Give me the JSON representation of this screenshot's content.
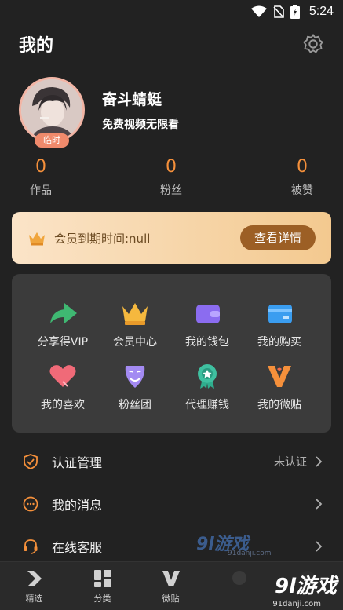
{
  "status_bar": {
    "time": "5:24"
  },
  "header": {
    "title": "我的"
  },
  "profile": {
    "username": "奋斗蜻蜓",
    "subtitle": "免费视频无限看",
    "badge": "临时"
  },
  "stats": [
    {
      "value": "0",
      "label": "作品"
    },
    {
      "value": "0",
      "label": "粉丝"
    },
    {
      "value": "0",
      "label": "被赞"
    }
  ],
  "vip": {
    "expiry_text": "会员到期时间:null",
    "button_label": "查看详情"
  },
  "grid": [
    {
      "label": "分享得VIP",
      "icon": "share-arrow-icon"
    },
    {
      "label": "会员中心",
      "icon": "crown-icon"
    },
    {
      "label": "我的钱包",
      "icon": "wallet-icon"
    },
    {
      "label": "我的购买",
      "icon": "card-icon"
    },
    {
      "label": "我的喜欢",
      "icon": "heart-icon"
    },
    {
      "label": "粉丝团",
      "icon": "mask-icon"
    },
    {
      "label": "代理赚钱",
      "icon": "medal-icon"
    },
    {
      "label": "我的微贴",
      "icon": "v-logo-icon"
    }
  ],
  "menu": [
    {
      "label": "认证管理",
      "right": "未认证",
      "icon": "shield-check-icon"
    },
    {
      "label": "我的消息",
      "right": "",
      "icon": "message-icon"
    },
    {
      "label": "在线客服",
      "right": "",
      "icon": "headset-icon"
    }
  ],
  "tabs": [
    {
      "label": "精选",
      "icon": "play-icon"
    },
    {
      "label": "分类",
      "icon": "grid-icon"
    },
    {
      "label": "微贴",
      "icon": "v-icon"
    },
    {
      "label": "",
      "icon": "tab-icon"
    },
    {
      "label": "",
      "icon": "profile-tab-icon"
    }
  ],
  "watermark": {
    "brand": "9l游戏",
    "domain": "91danji.com"
  },
  "colors": {
    "accent": "#f5903b",
    "background": "#222222",
    "card": "#3b3b3b"
  }
}
